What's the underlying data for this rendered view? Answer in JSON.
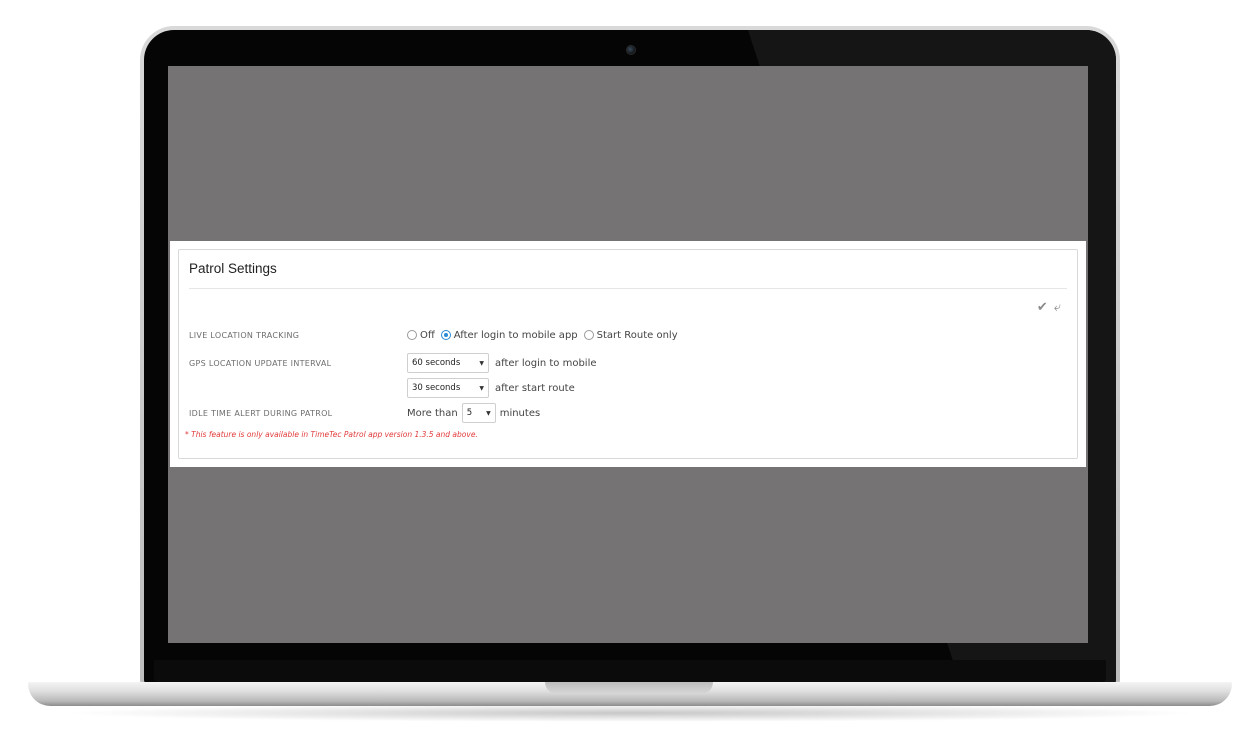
{
  "panel": {
    "title": "Patrol Settings",
    "actions": {
      "save_icon": "check-icon",
      "undo_icon": "undo-icon"
    }
  },
  "live_location": {
    "label": "LIVE LOCATION TRACKING",
    "options": [
      "Off",
      "After login to mobile app",
      "Start Route only"
    ],
    "selected": "After login to mobile app"
  },
  "gps_interval": {
    "label": "GPS LOCATION UPDATE INTERVAL",
    "login_value": "60 seconds",
    "login_suffix": "after login to mobile",
    "route_value": "30 seconds",
    "route_suffix": "after start route"
  },
  "idle_alert": {
    "label": "IDLE TIME ALERT DURING PATROL",
    "prefix": "More than",
    "value": "5",
    "suffix": "minutes"
  },
  "footnote": "* This feature is only available in TimeTec Patrol app version 1.3.5 and above.",
  "colors": {
    "screen_bg": "#757373",
    "accent": "#2b8ad6",
    "note": "#e23a3a"
  }
}
